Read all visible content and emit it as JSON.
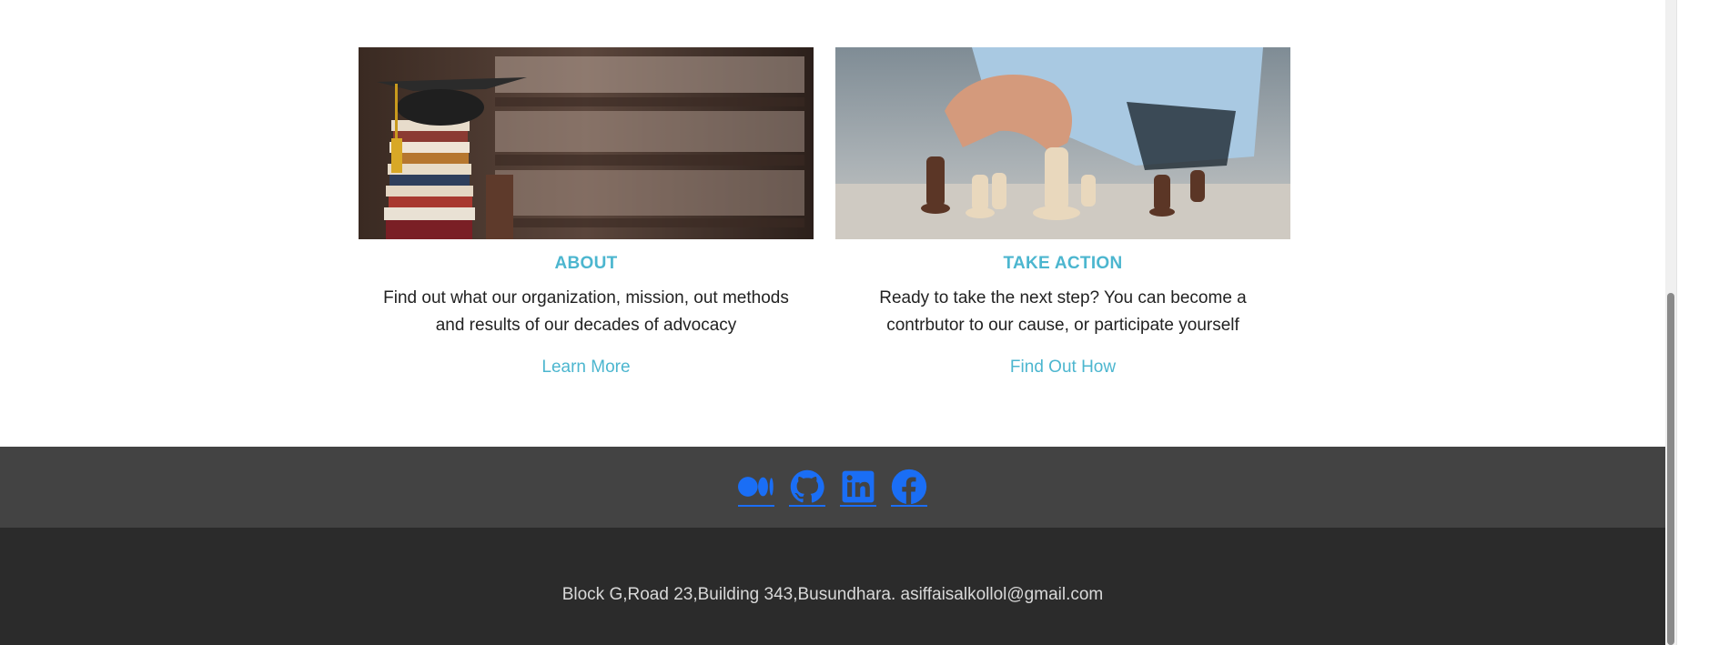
{
  "cards": [
    {
      "title": "ABOUT",
      "text": "Find out what our organization, mission, out methods and results of our decades of advocacy",
      "link": "Learn More"
    },
    {
      "title": "TAKE ACTION",
      "text": "Ready to take the next step? You can become a contrbutor to our cause, or participate yourself",
      "link": "Find Out How"
    }
  ],
  "social": {
    "icons": [
      "medium-icon",
      "github-icon",
      "linkedin-icon",
      "facebook-icon"
    ],
    "color": "#1a6ef5"
  },
  "footer": {
    "address": "Block G,Road 23,Building 343,Busundhara. asiffaisalkollol@gmail.com"
  },
  "colors": {
    "accent": "#4cb6cf",
    "social_bar": "#434343",
    "footer_bg": "#2b2b2b"
  }
}
